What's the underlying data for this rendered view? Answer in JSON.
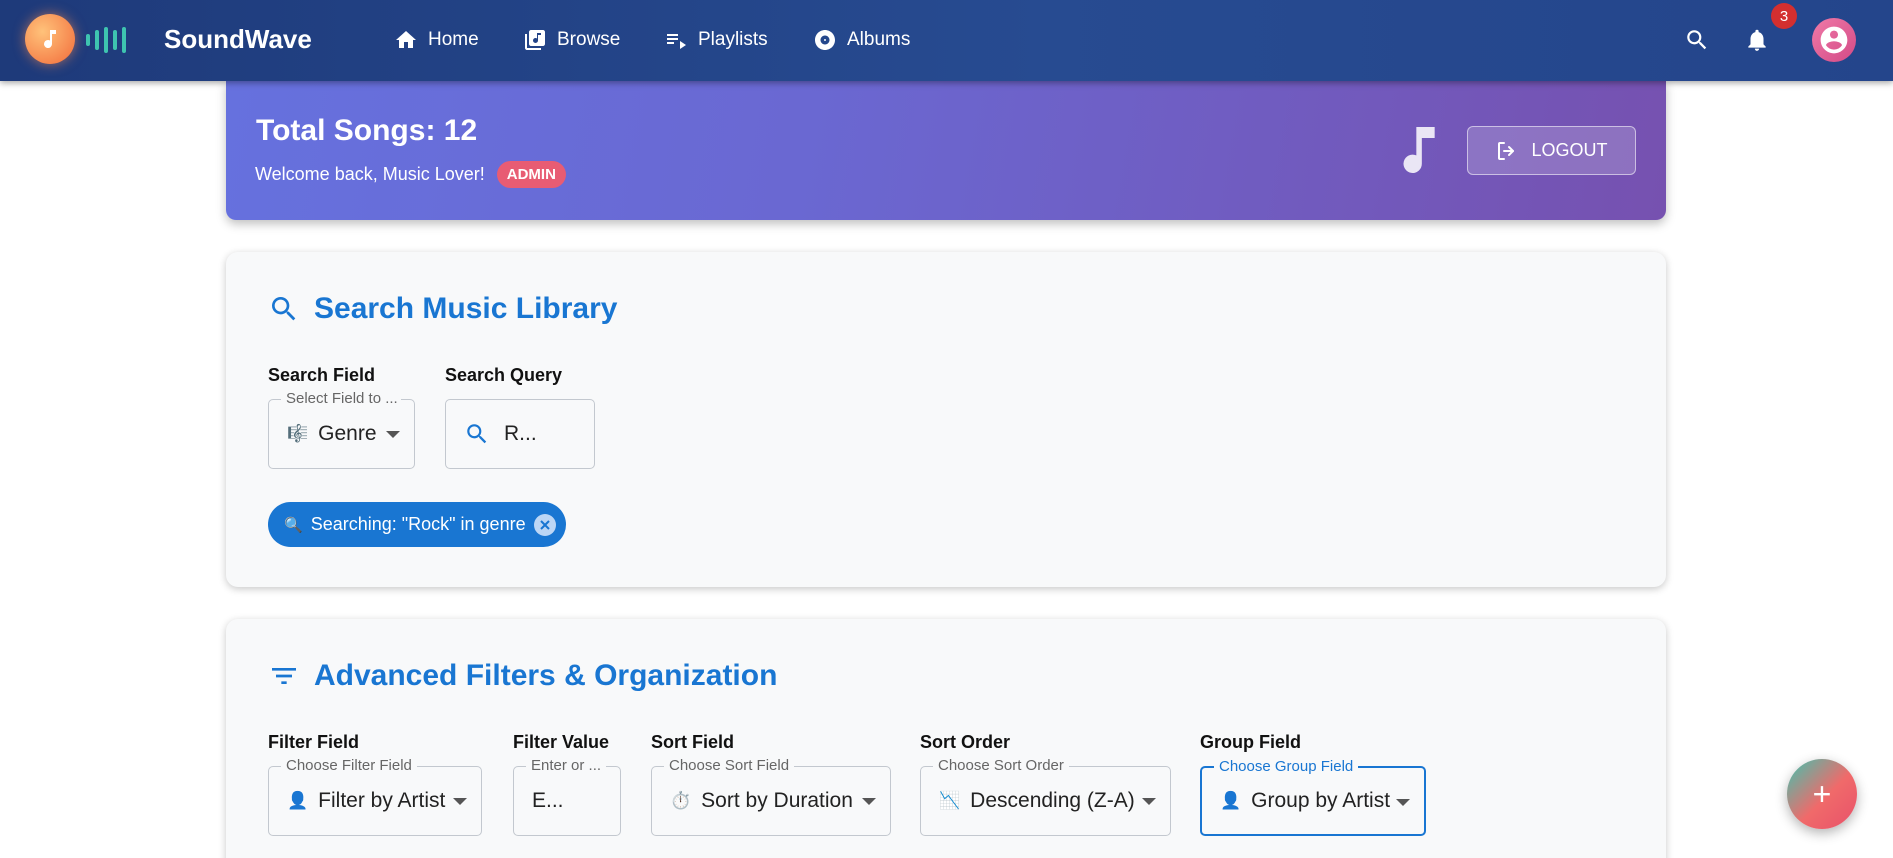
{
  "app": {
    "name": "SoundWave",
    "notification_count": "3"
  },
  "nav": {
    "items": [
      {
        "label": "Home",
        "icon": "home-icon"
      },
      {
        "label": "Browse",
        "icon": "library-music-icon"
      },
      {
        "label": "Playlists",
        "icon": "playlist-play-icon"
      },
      {
        "label": "Albums",
        "icon": "album-icon"
      }
    ]
  },
  "hero": {
    "title": "Total Songs: 12",
    "welcome": "Welcome back, Music Lover!",
    "role": "ADMIN",
    "logout_label": "LOGOUT"
  },
  "search": {
    "title": "Search Music Library",
    "field_label": "Search Field",
    "field_floating": "Select Field to ...",
    "field_value": "Genre",
    "field_emoji": "🎼",
    "query_label": "Search Query",
    "query_value": "R...",
    "chip_icon": "🔍",
    "chip_text": "Searching: \"Rock\" in genre"
  },
  "filters": {
    "title": "Advanced Filters & Organization",
    "filter_field": {
      "label": "Filter Field",
      "floating": "Choose Filter Field",
      "value": "Filter by Artist",
      "emoji": "👤"
    },
    "filter_value": {
      "label": "Filter Value",
      "floating": "Enter or ...",
      "value": "E..."
    },
    "sort_field": {
      "label": "Sort Field",
      "floating": "Choose Sort Field",
      "value": "Sort by Duration",
      "emoji": "⏱️"
    },
    "sort_order": {
      "label": "Sort Order",
      "floating": "Choose Sort Order",
      "value": "Descending (Z-A)",
      "emoji": "📉"
    },
    "group_field": {
      "label": "Group Field",
      "floating": "Choose Group Field",
      "value": "Group by Artist",
      "emoji": "👤"
    }
  },
  "fab": {
    "symbol": "+"
  },
  "colors": {
    "accent": "#1976d2",
    "nav_bg": "#274b91",
    "badge": "#d32f2f",
    "role_badge": "#e85c73"
  }
}
